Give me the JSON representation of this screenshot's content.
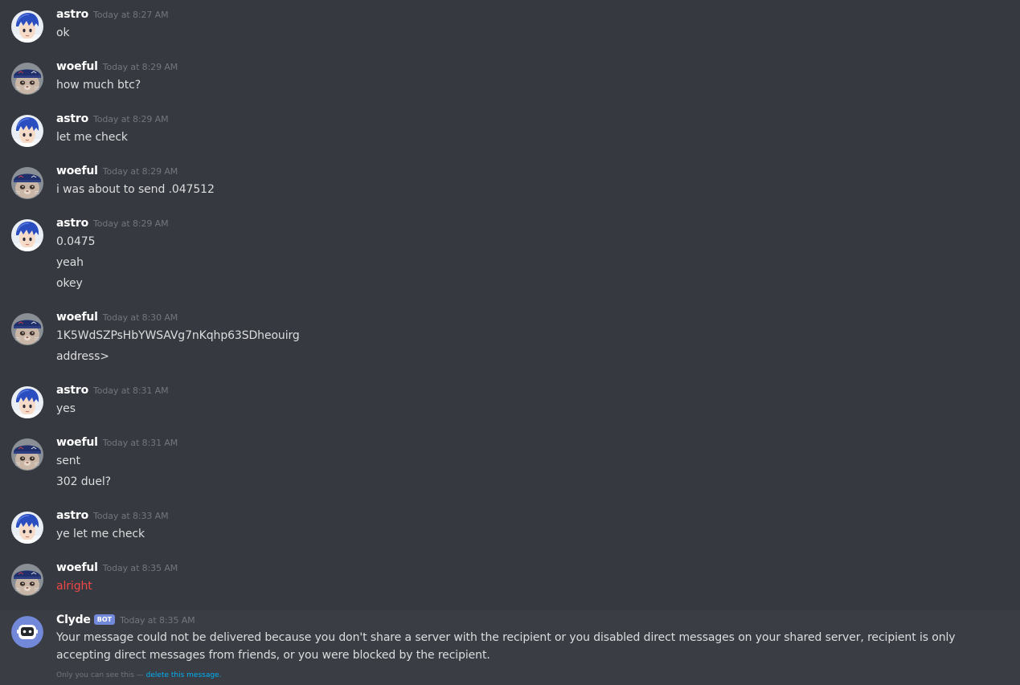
{
  "colors": {
    "background": "#36393f",
    "username": "#ffffff",
    "timestamp": "#72767d",
    "message_text": "#dcddde",
    "failed_message": "#f04747",
    "bot_tag": "#7289da",
    "link": "#00b0f4"
  },
  "groups": [
    {
      "author": "astro",
      "avatar": "astro-avatar",
      "timestamp": "Today at 8:27 AM",
      "messages": [
        "ok"
      ]
    },
    {
      "author": "woeful",
      "avatar": "woeful-avatar",
      "timestamp": "Today at 8:29 AM",
      "messages": [
        "how much btc?"
      ]
    },
    {
      "author": "astro",
      "avatar": "astro-avatar",
      "timestamp": "Today at 8:29 AM",
      "messages": [
        "let me check"
      ]
    },
    {
      "author": "woeful",
      "avatar": "woeful-avatar",
      "timestamp": "Today at 8:29 AM",
      "messages": [
        "i was about to send .047512"
      ]
    },
    {
      "author": "astro",
      "avatar": "astro-avatar",
      "timestamp": "Today at 8:29 AM",
      "messages": [
        "0.0475",
        "yeah",
        "okey"
      ]
    },
    {
      "author": "woeful",
      "avatar": "woeful-avatar",
      "timestamp": "Today at 8:30 AM",
      "messages": [
        "1K5WdSZPsHbYWSAVg7nKqhp63SDheouirg",
        "address>"
      ]
    },
    {
      "author": "astro",
      "avatar": "astro-avatar",
      "timestamp": "Today at 8:31 AM",
      "messages": [
        "yes"
      ]
    },
    {
      "author": "woeful",
      "avatar": "woeful-avatar",
      "timestamp": "Today at 8:31 AM",
      "messages": [
        "sent",
        "302 duel?"
      ]
    },
    {
      "author": "astro",
      "avatar": "astro-avatar",
      "timestamp": "Today at 8:33 AM",
      "messages": [
        "ye let me check"
      ]
    },
    {
      "author": "woeful",
      "avatar": "woeful-avatar",
      "timestamp": "Today at 8:35 AM",
      "messages": [
        "alright"
      ],
      "failed": true
    }
  ],
  "clyde": {
    "author": "Clyde",
    "bot_tag": "BOT",
    "avatar": "clyde-bot-avatar",
    "timestamp": "Today at 8:35 AM",
    "message": "Your message could not be delivered because you don't share a server with the recipient or you disabled direct messages on your shared server, recipient is only accepting direct messages from friends, or you were blocked by the recipient.",
    "ephemeral_note": "Only you can see this — ",
    "delete_link": "delete this message."
  }
}
